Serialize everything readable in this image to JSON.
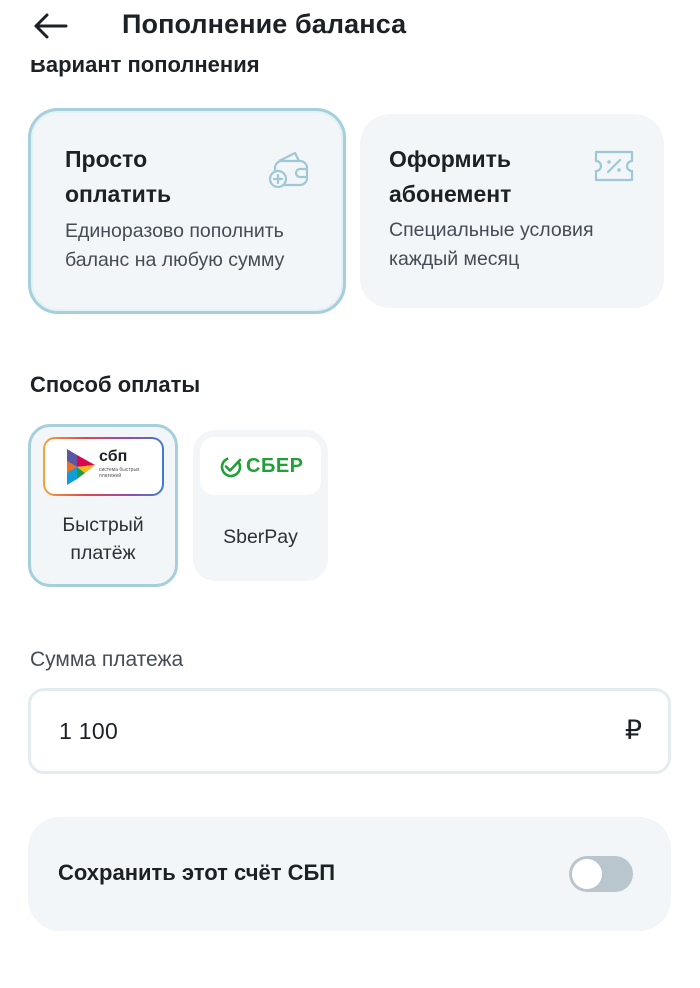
{
  "header": {
    "back_icon": "arrow-left-icon",
    "title": "Пополнение баланса"
  },
  "section_top": {
    "label": "Вариант пополнения"
  },
  "options": [
    {
      "title_line1": "Просто",
      "title_line2": "оплатить",
      "desc_line1": "Единоразово пополнить",
      "desc_line2": "баланс на любую сумму",
      "icon": "wallet-plus-icon",
      "selected": true
    },
    {
      "title_line1": "Оформить",
      "title_line2": "абонемент",
      "desc_line1": "Специальные условия",
      "desc_line2": "каждый месяц",
      "icon": "ticket-percent-icon",
      "selected": false
    }
  ],
  "payment": {
    "label": "Способ оплаты",
    "methods": [
      {
        "logo_text": "сбп",
        "logo_subtext": "система быстрых платежей",
        "label_line1": "Быстрый",
        "label_line2": "платёж",
        "selected": true
      },
      {
        "logo_text": "СБЕР",
        "label": "SberPay",
        "selected": false
      }
    ]
  },
  "amount": {
    "label": "Сумма платежа",
    "value": "1 100",
    "currency": "₽"
  },
  "save_account": {
    "label": "Сохранить этот счёт СБП",
    "enabled": false
  },
  "colors": {
    "selected_border": "#a5cfdb",
    "card_bg": "#f2f6f9",
    "sber_green": "#21a038",
    "toggle_off": "#b9c6cd"
  }
}
